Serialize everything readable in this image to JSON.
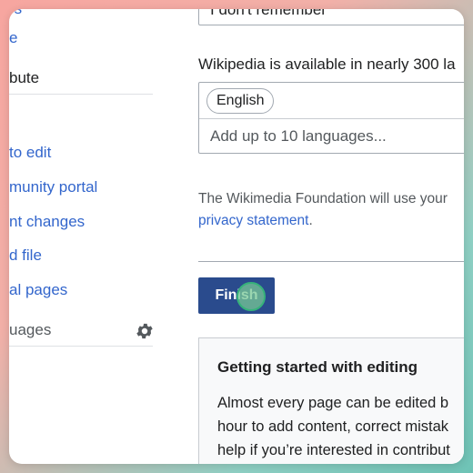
{
  "sidebar": {
    "top_partial": "rs",
    "items_top": [
      {
        "label": "e",
        "link": true
      },
      {
        "label": "bute",
        "link": false
      }
    ],
    "tools": [
      {
        "label": "to edit"
      },
      {
        "label": "munity portal"
      },
      {
        "label": "nt changes"
      },
      {
        "label": "d file"
      },
      {
        "label": "al pages"
      }
    ],
    "languages_label": "uages",
    "settings_icon": "gear-icon"
  },
  "main": {
    "top_field_text": "I don't remember",
    "languages_intro": "Wikipedia is available in nearly 300 la",
    "selected_language": "English",
    "language_placeholder": "Add up to 10 languages...",
    "privacy_text": "The Wikimedia Foundation will use your",
    "privacy_link": "privacy statement",
    "privacy_period": ".",
    "finish_label": "Finish",
    "getting_started_title": "Getting started with editing",
    "getting_started_lines": [
      "Almost every page can be edited b",
      "hour to add content, correct mistak",
      "help if you’re interested in contribut"
    ]
  },
  "colors": {
    "link": "#3366cc",
    "primary_button": "#2a4b8d",
    "text": "#202122"
  }
}
